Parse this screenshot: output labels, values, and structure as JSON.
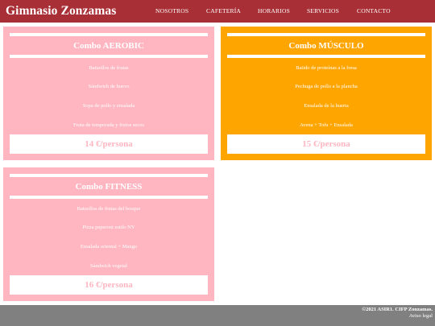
{
  "header": {
    "logo": "Gimnasio Zonzamas",
    "nav": [
      "NOSOTROS",
      "CAFETERÍA",
      "HORARIOS",
      "SERVICIOS",
      "CONTACTO"
    ]
  },
  "combos": [
    {
      "title": "Combo AEROBIC",
      "items": [
        "Batuollos de frutas",
        "Sándwich de huevo",
        "Sopa de pollo y ensalada",
        "Fruta de temporada y frutos secos"
      ],
      "price": "14 €/persona",
      "color": "#ffb6c1"
    },
    {
      "title": "Combo MÚSCULO",
      "items": [
        "Batido de proteínas a la fresa",
        "Pechuga de pollo a la plancha",
        "Ensalada de la huerta",
        "Avena + Tofu + Ensalada"
      ],
      "price": "15 €/persona",
      "color": "#ffa500"
    },
    {
      "title": "Combo FITNESS",
      "items": [
        "Batuollos de frutas del bosque",
        "Pizza peperoni estilo NY",
        "Ensalada oriental + Mango",
        "Sándwich vegetal"
      ],
      "price": "16 €/persona",
      "color": "#ffb6c1"
    }
  ],
  "footer": {
    "copyright": "©2021 ASIR1. CIFP Zonzamas.",
    "legal": "Aviso legal"
  },
  "colors": {
    "header_bg": "#a82f35",
    "pink": "#ffb6c1",
    "orange": "#ffa500",
    "footer_bg": "#808080"
  }
}
